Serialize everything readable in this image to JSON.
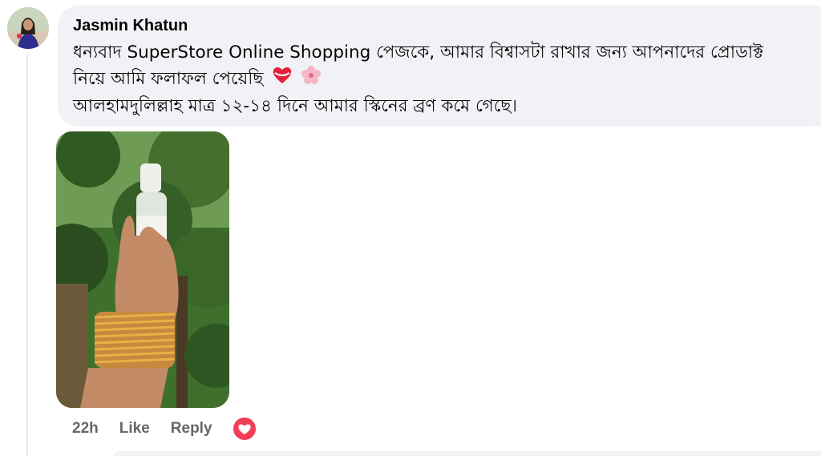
{
  "comment": {
    "author": "Jasmin Khatun",
    "line1": "ধন্যবাদ SuperStore Online Shopping পেজকে, আমার বিশ্বাসটা রাখার জন্য আপনাদের প্রোডাক্ট",
    "line2": "নিয়ে আমি ফলাফল পেয়েছি",
    "line3": "আলহামদুলিল্লাহ মাত্র ১২-১৪ দিনে আমার স্কিনের ব্রণ কমে গেছে।",
    "emojis": [
      "heart-ribbon-icon",
      "cherry-blossom-icon"
    ]
  },
  "actions": {
    "time": "22h",
    "like": "Like",
    "reply": "Reply",
    "reaction": "love-reaction-icon"
  },
  "colors": {
    "bubble": "#f0f2f5",
    "muted": "#65676b",
    "love": "#f33e58"
  }
}
